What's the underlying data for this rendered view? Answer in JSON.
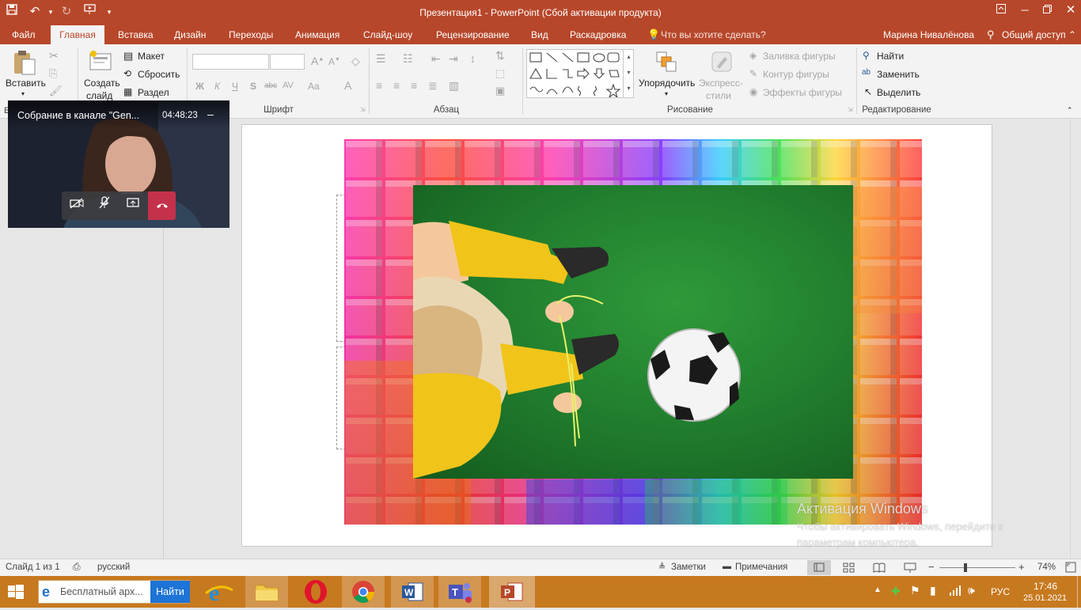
{
  "window": {
    "title": "Презентация1 - PowerPoint (Сбой активации продукта)"
  },
  "tabs": {
    "file": "Файл",
    "home": "Главная",
    "insert": "Вставка",
    "design": "Дизайн",
    "transitions": "Переходы",
    "animation": "Анимация",
    "slideshow": "Слайд-шоу",
    "review": "Рецензирование",
    "view": "Вид",
    "storyboard": "Раскадровка",
    "tell_me": "Что вы хотите сделать?",
    "user": "Марина Нивалёнова",
    "share": "Общий доступ"
  },
  "ribbon": {
    "clipboard": {
      "paste": "Вставить",
      "label": "Б"
    },
    "slides": {
      "new_slide_1": "Создать",
      "new_slide_2": "слайд",
      "layout": "Макет",
      "reset": "Сбросить",
      "section": "Раздел"
    },
    "font": {
      "label": "Шрифт",
      "bold": "Ж",
      "italic": "К",
      "underline": "Ч",
      "shadow": "S",
      "strike": "abc",
      "spacing": "AV",
      "case": "Aa",
      "color": "A",
      "grow": "A",
      "shrink": "A"
    },
    "paragraph": {
      "label": "Абзац"
    },
    "drawing": {
      "label": "Рисование",
      "arrange": "Упорядочить",
      "quick_styles_1": "Экспресс-",
      "quick_styles_2": "стили",
      "fill": "Заливка фигуры",
      "outline": "Контур фигуры",
      "effects": "Эффекты фигуры"
    },
    "editing": {
      "label": "Редактирование",
      "find": "Найти",
      "replace": "Заменить",
      "select": "Выделить"
    }
  },
  "teams": {
    "meeting_title": "Собрание в канале \"Gen...",
    "timer": "04:48:23",
    "minimize": "–"
  },
  "watermark": {
    "title": "Активация Windows",
    "line1": "Чтобы активировать Windows, перейдите к",
    "line2": "параметрам компьютера."
  },
  "statusbar": {
    "slide_info": "Слайд 1 из 1",
    "language": "русский",
    "notes": "Заметки",
    "comments": "Примечания",
    "zoom": "74%"
  },
  "taskbar": {
    "search_text": "Бесплатный арх...",
    "search_button": "Найти",
    "lang": "РУС",
    "time": "17:46",
    "date": "25.01.2021"
  },
  "colors": {
    "accent": "#b7472a",
    "taskbar": "#c7791f",
    "ribbon": "#f3f3f3"
  }
}
